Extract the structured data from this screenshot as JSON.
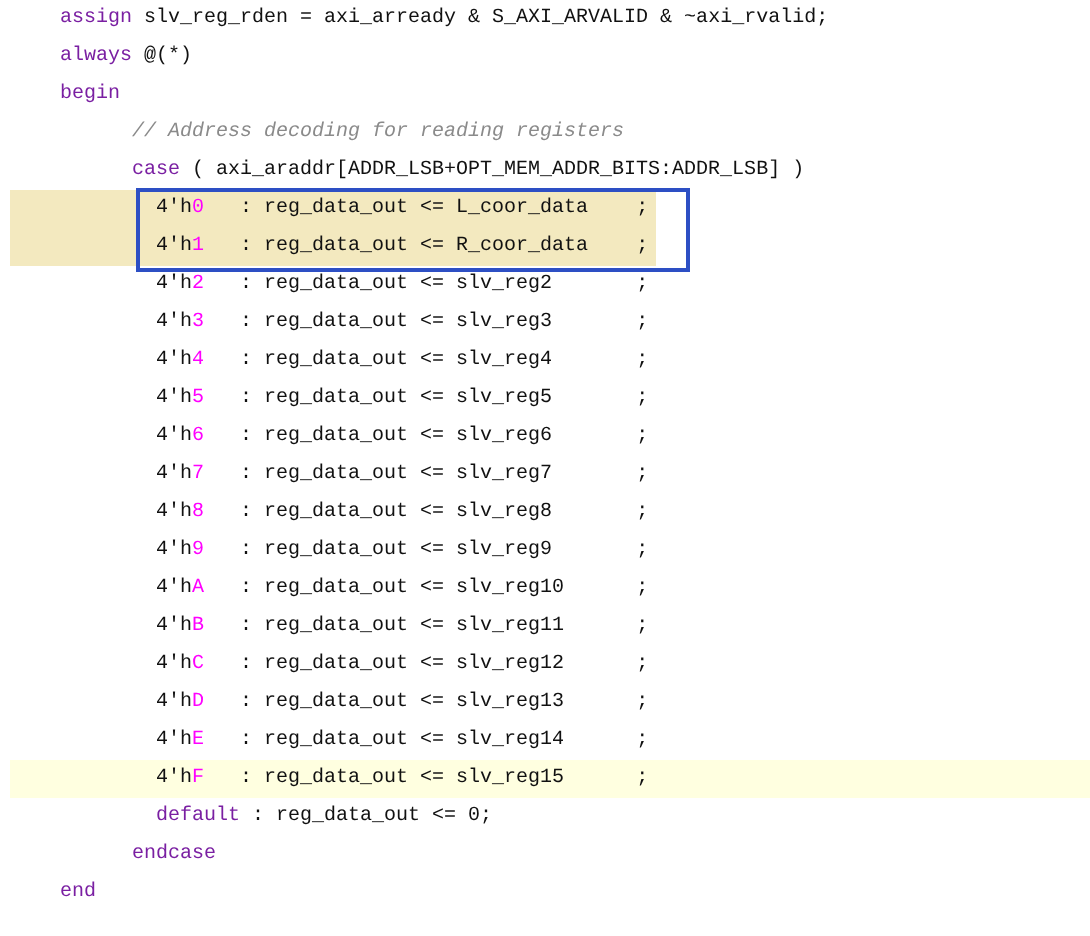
{
  "editor": {
    "lines": [
      {
        "tokens": [
          {
            "kind": "keyword",
            "text": "    assign"
          },
          {
            "kind": "text",
            "text": " slv_reg_rden = axi_arready & S_AXI_ARVALID & ~axi_rvalid;"
          }
        ]
      },
      {
        "tokens": [
          {
            "kind": "keyword",
            "text": "    always"
          },
          {
            "kind": "text",
            "text": " @(*)"
          }
        ]
      },
      {
        "tokens": [
          {
            "kind": "keyword",
            "text": "    begin"
          }
        ]
      },
      {
        "tokens": [
          {
            "kind": "comment",
            "text": "          // Address decoding for reading registers"
          }
        ]
      },
      {
        "tokens": [
          {
            "kind": "keyword",
            "text": "          case"
          },
          {
            "kind": "text",
            "text": " ( axi_araddr[ADDR_LSB+OPT_MEM_ADDR_BITS:ADDR_LSB] )"
          }
        ]
      },
      {
        "selected": true,
        "boxed": true,
        "tokens": [
          {
            "kind": "text",
            "text": "            4'h"
          },
          {
            "kind": "number",
            "text": "0"
          },
          {
            "kind": "text",
            "text": "   : reg_data_out <= L_coor_data    ;"
          }
        ]
      },
      {
        "selected": true,
        "boxed": true,
        "tokens": [
          {
            "kind": "text",
            "text": "            4'h"
          },
          {
            "kind": "number",
            "text": "1"
          },
          {
            "kind": "text",
            "text": "   : reg_data_out <= R_coor_data    ;"
          }
        ]
      },
      {
        "tokens": [
          {
            "kind": "text",
            "text": "            4'h"
          },
          {
            "kind": "number",
            "text": "2"
          },
          {
            "kind": "text",
            "text": "   : reg_data_out <= slv_reg2       ;"
          }
        ]
      },
      {
        "tokens": [
          {
            "kind": "text",
            "text": "            4'h"
          },
          {
            "kind": "number",
            "text": "3"
          },
          {
            "kind": "text",
            "text": "   : reg_data_out <= slv_reg3       ;"
          }
        ]
      },
      {
        "tokens": [
          {
            "kind": "text",
            "text": "            4'h"
          },
          {
            "kind": "number",
            "text": "4"
          },
          {
            "kind": "text",
            "text": "   : reg_data_out <= slv_reg4       ;"
          }
        ]
      },
      {
        "tokens": [
          {
            "kind": "text",
            "text": "            4'h"
          },
          {
            "kind": "number",
            "text": "5"
          },
          {
            "kind": "text",
            "text": "   : reg_data_out <= slv_reg5       ;"
          }
        ]
      },
      {
        "tokens": [
          {
            "kind": "text",
            "text": "            4'h"
          },
          {
            "kind": "number",
            "text": "6"
          },
          {
            "kind": "text",
            "text": "   : reg_data_out <= slv_reg6       ;"
          }
        ]
      },
      {
        "tokens": [
          {
            "kind": "text",
            "text": "            4'h"
          },
          {
            "kind": "number",
            "text": "7"
          },
          {
            "kind": "text",
            "text": "   : reg_data_out <= slv_reg7       ;"
          }
        ]
      },
      {
        "tokens": [
          {
            "kind": "text",
            "text": "            4'h"
          },
          {
            "kind": "number",
            "text": "8"
          },
          {
            "kind": "text",
            "text": "   : reg_data_out <= slv_reg8       ;"
          }
        ]
      },
      {
        "tokens": [
          {
            "kind": "text",
            "text": "            4'h"
          },
          {
            "kind": "number",
            "text": "9"
          },
          {
            "kind": "text",
            "text": "   : reg_data_out <= slv_reg9       ;"
          }
        ]
      },
      {
        "tokens": [
          {
            "kind": "text",
            "text": "            4'h"
          },
          {
            "kind": "number",
            "text": "A"
          },
          {
            "kind": "text",
            "text": "   : reg_data_out <= slv_reg10      ;"
          }
        ]
      },
      {
        "tokens": [
          {
            "kind": "text",
            "text": "            4'h"
          },
          {
            "kind": "number",
            "text": "B"
          },
          {
            "kind": "text",
            "text": "   : reg_data_out <= slv_reg11      ;"
          }
        ]
      },
      {
        "tokens": [
          {
            "kind": "text",
            "text": "            4'h"
          },
          {
            "kind": "number",
            "text": "C"
          },
          {
            "kind": "text",
            "text": "   : reg_data_out <= slv_reg12      ;"
          }
        ]
      },
      {
        "tokens": [
          {
            "kind": "text",
            "text": "            4'h"
          },
          {
            "kind": "number",
            "text": "D"
          },
          {
            "kind": "text",
            "text": "   : reg_data_out <= slv_reg13      ;"
          }
        ]
      },
      {
        "tokens": [
          {
            "kind": "text",
            "text": "            4'h"
          },
          {
            "kind": "number",
            "text": "E"
          },
          {
            "kind": "text",
            "text": "   : reg_data_out <= slv_reg14      ;"
          }
        ]
      },
      {
        "current": true,
        "tokens": [
          {
            "kind": "text",
            "text": "            4'h"
          },
          {
            "kind": "number",
            "text": "F"
          },
          {
            "kind": "text",
            "text": "   : reg_data_out <= slv_reg15      ;"
          }
        ]
      },
      {
        "tokens": [
          {
            "kind": "keyword",
            "text": "            default"
          },
          {
            "kind": "text",
            "text": " : reg_data_out <= 0;"
          }
        ]
      },
      {
        "tokens": [
          {
            "kind": "keyword",
            "text": "          endcase"
          }
        ]
      },
      {
        "tokens": [
          {
            "kind": "keyword",
            "text": "    end"
          }
        ]
      }
    ]
  }
}
